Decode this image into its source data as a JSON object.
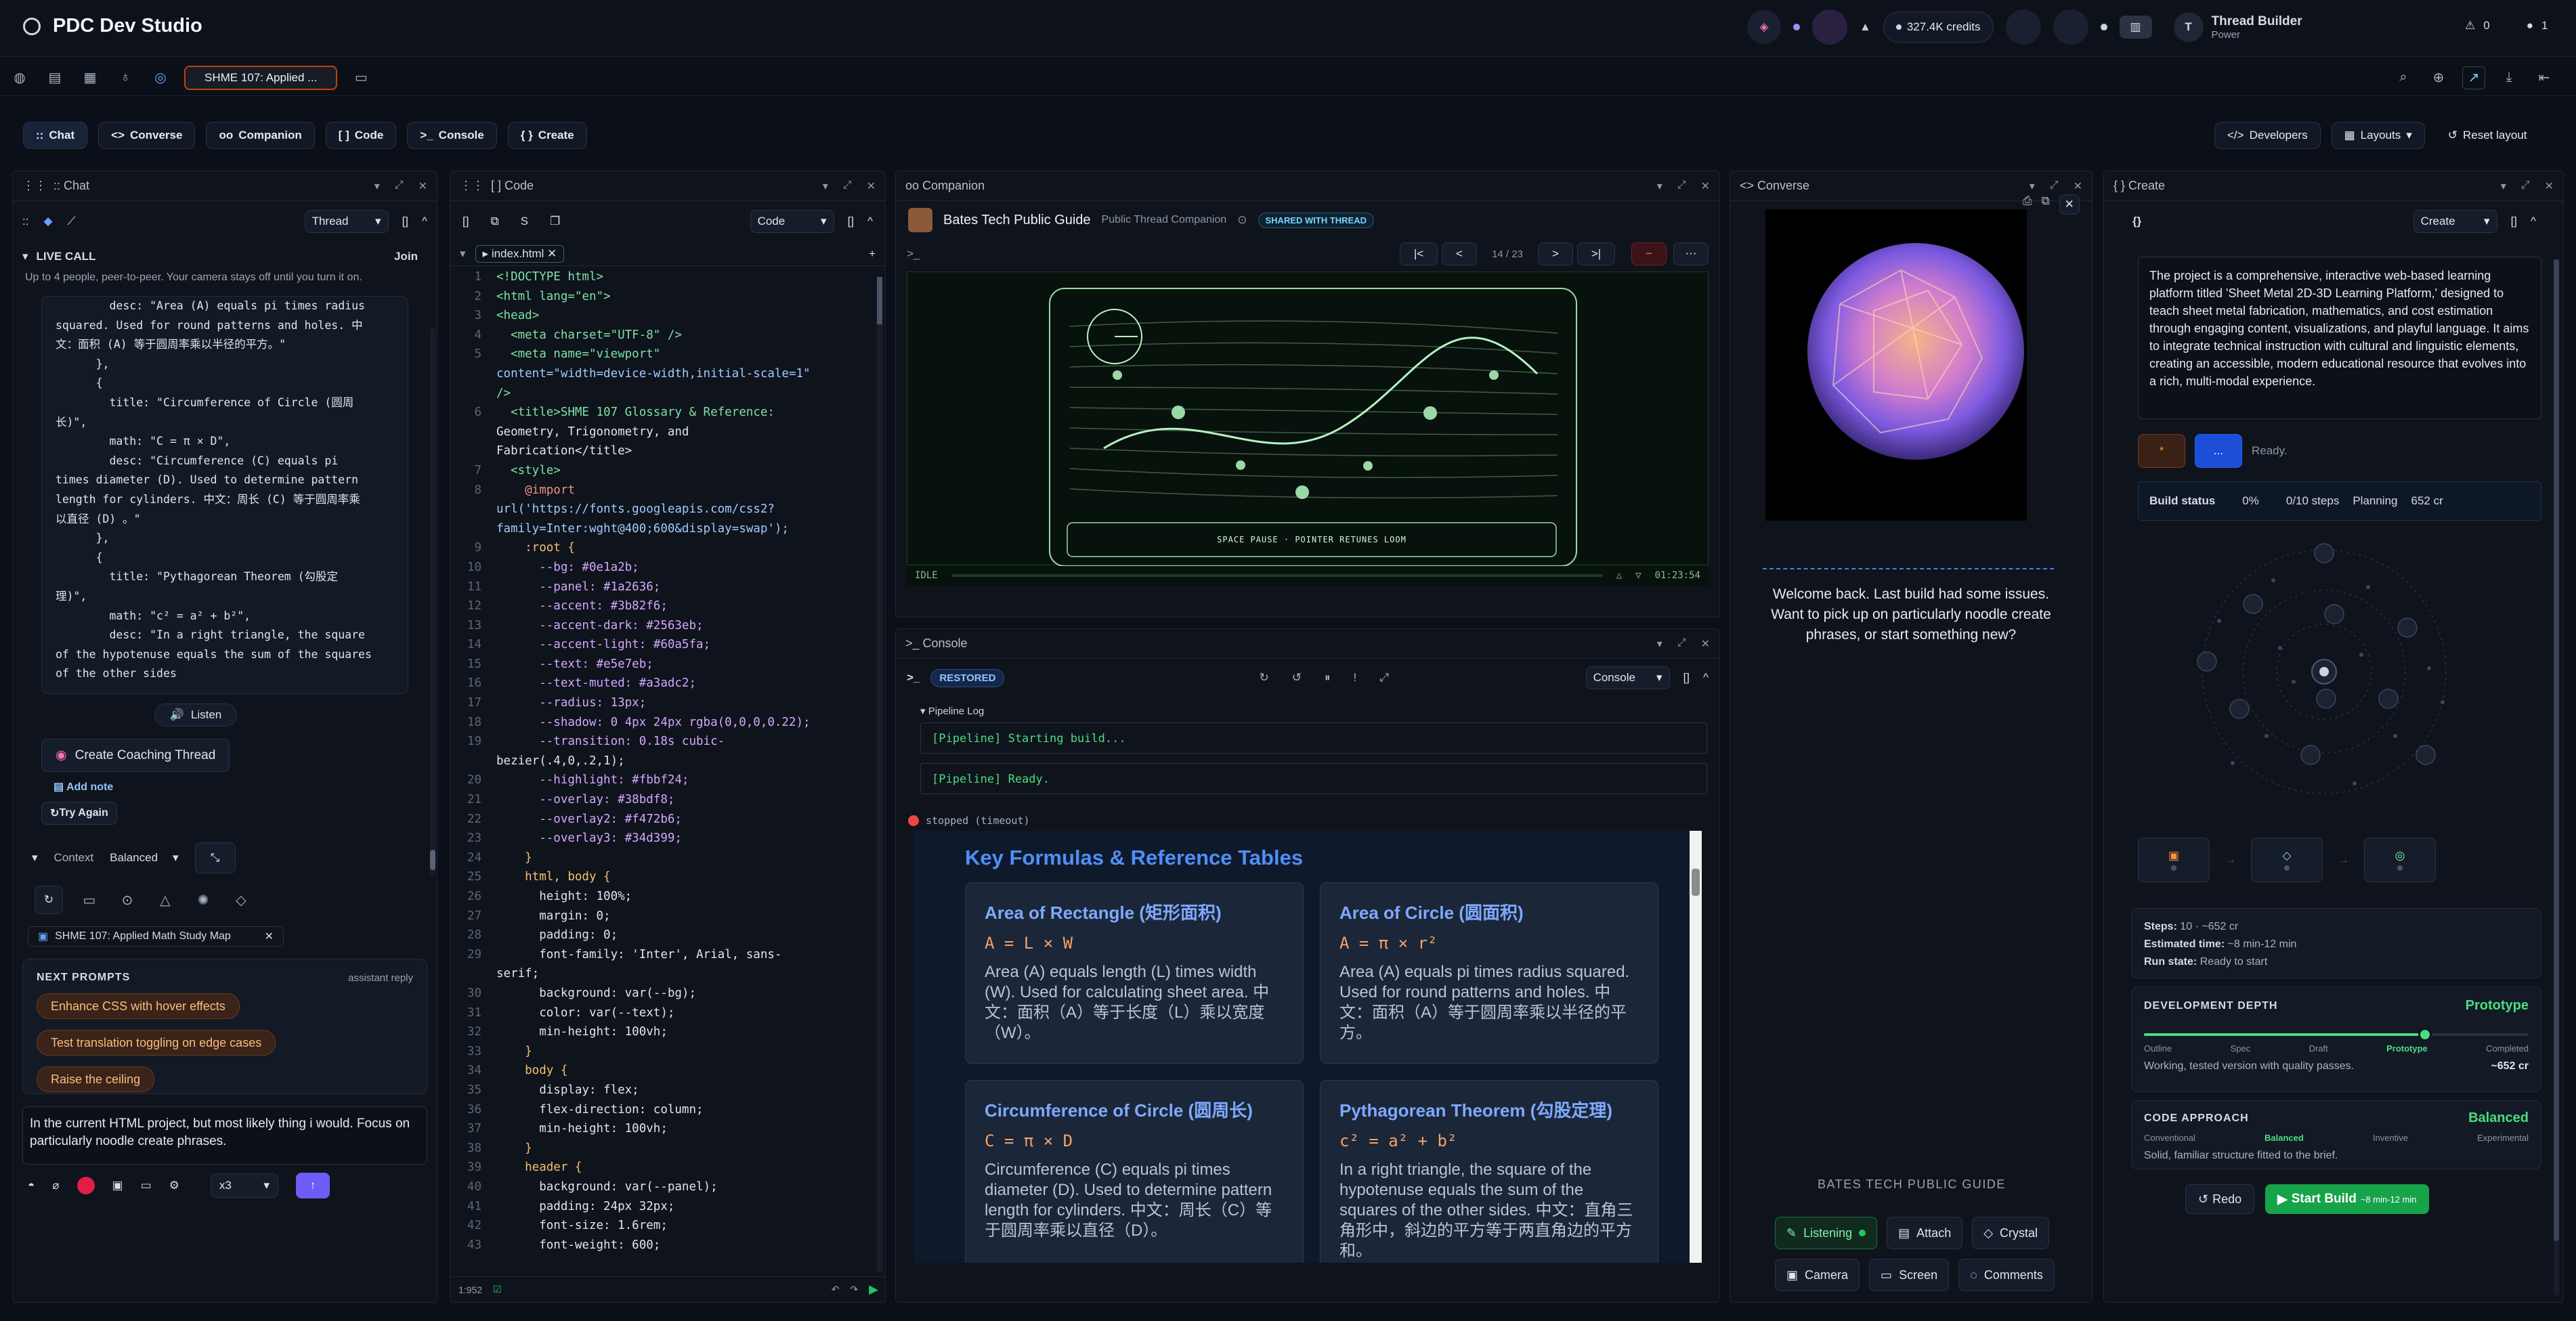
{
  "app": {
    "title": "PDC Dev Studio",
    "credits": "327.4K credits",
    "user_name": "Thread Builder",
    "user_tier": "Power",
    "user_initial": "T",
    "warnings": "0",
    "notifications": "1"
  },
  "tabbar": {
    "active_tab": "SHME 107: Applied ..."
  },
  "modes": [
    "Chat",
    "Converse",
    "Companion",
    "Code",
    "Console",
    "Create"
  ],
  "mode_prefixes": [
    "::",
    "<>",
    "oo",
    "[ ]",
    ">_",
    "{ }"
  ],
  "right_actions": {
    "developers": "Developers",
    "layouts": "Layouts",
    "reset": "Reset layout"
  },
  "chat": {
    "panel_title": ":: Chat",
    "thread_select": "Thread",
    "live_call": {
      "title": "LIVE CALL",
      "join": "Join",
      "desc": "Up to 4 people, peer-to-peer. Your camera stays off until you turn it on."
    },
    "code_lines": [
      "        desc: \"Area (A) equals pi times radius",
      "squared. Used for round patterns and holes. 中",
      "文：面积 (A) 等于圆周率乘以半径的平方。\"",
      "      },",
      "      {",
      "        title: \"Circumference of Circle (圆周",
      "长)\",",
      "        math: \"C = π × D\",",
      "        desc: \"Circumference (C) equals pi",
      "times diameter (D). Used to determine pattern",
      "length for cylinders. 中文：周长 (C) 等于圆周率乘",
      "以直径 (D) 。\"",
      "      },",
      "      {",
      "        title: \"Pythagorean Theorem (勾股定",
      "理)\",",
      "        math: \"c² = a² + b²\",",
      "        desc: \"In a right triangle, the square",
      "of the hypotenuse equals the sum of the squares",
      "of the other sides"
    ],
    "listen": "Listen",
    "create_coaching": "Create Coaching Thread",
    "add_note": "Add note",
    "try_again": "Try Again",
    "context_label": "Context",
    "context_value": "Balanced",
    "context_tag": "SHME 107: Applied Math Study Map",
    "next_prompts_title": "NEXT PROMPTS",
    "next_prompts_meta": "assistant reply",
    "prompts": [
      "Enhance CSS with hover effects",
      "Test translation toggling on edge cases",
      "Raise the ceiling"
    ],
    "input_text": "In the current HTML project, but most likely thing i would. Focus on particularly noodle create phrases.",
    "multiplier": "x3"
  },
  "code": {
    "panel_title": "[ ] Code",
    "mode_select": "Code",
    "file_tab": "index.html",
    "lines": [
      [
        "1",
        "<!DOCTYPE html>"
      ],
      [
        "2",
        "<html lang=\"en\">"
      ],
      [
        "3",
        "<head>"
      ],
      [
        "4",
        "  <meta charset=\"UTF-8\" />"
      ],
      [
        "5",
        "  <meta name=\"viewport\""
      ],
      [
        "",
        "content=\"width=device-width,initial-scale=1\""
      ],
      [
        "",
        "/>"
      ],
      [
        "6",
        "  <title>SHME 107 Glossary & Reference:"
      ],
      [
        "",
        "Geometry, Trigonometry, and"
      ],
      [
        "",
        "Fabrication</title>"
      ],
      [
        "7",
        "  <style>"
      ],
      [
        "8",
        "    @import"
      ],
      [
        "",
        "url('https://fonts.googleapis.com/css2?"
      ],
      [
        "",
        "family=Inter:wght@400;600&display=swap');"
      ],
      [
        "9",
        "    :root {"
      ],
      [
        "10",
        "      --bg: #0e1a2b;"
      ],
      [
        "11",
        "      --panel: #1a2636;"
      ],
      [
        "12",
        "      --accent: #3b82f6;"
      ],
      [
        "13",
        "      --accent-dark: #2563eb;"
      ],
      [
        "14",
        "      --accent-light: #60a5fa;"
      ],
      [
        "15",
        "      --text: #e5e7eb;"
      ],
      [
        "16",
        "      --text-muted: #a3adc2;"
      ],
      [
        "17",
        "      --radius: 13px;"
      ],
      [
        "18",
        "      --shadow: 0 4px 24px rgba(0,0,0,0.22);"
      ],
      [
        "19",
        "      --transition: 0.18s cubic-"
      ],
      [
        "",
        "bezier(.4,0,.2,1);"
      ],
      [
        "20",
        "      --highlight: #fbbf24;"
      ],
      [
        "21",
        "      --overlay: #38bdf8;"
      ],
      [
        "22",
        "      --overlay2: #f472b6;"
      ],
      [
        "23",
        "      --overlay3: #34d399;"
      ],
      [
        "24",
        "    }"
      ],
      [
        "25",
        "    html, body {"
      ],
      [
        "26",
        "      height: 100%;"
      ],
      [
        "27",
        "      margin: 0;"
      ],
      [
        "28",
        "      padding: 0;"
      ],
      [
        "29",
        "      font-family: 'Inter', Arial, sans-"
      ],
      [
        "",
        "serif;"
      ],
      [
        "30",
        "      background: var(--bg);"
      ],
      [
        "31",
        "      color: var(--text);"
      ],
      [
        "32",
        "      min-height: 100vh;"
      ],
      [
        "33",
        "    }"
      ],
      [
        "34",
        "    body {"
      ],
      [
        "35",
        "      display: flex;"
      ],
      [
        "36",
        "      flex-direction: column;"
      ],
      [
        "37",
        "      min-height: 100vh;"
      ],
      [
        "38",
        "    }"
      ],
      [
        "39",
        "    header {"
      ],
      [
        "40",
        "      background: var(--panel);"
      ],
      [
        "41",
        "      padding: 24px 32px;"
      ],
      [
        "42",
        "      font-size: 1.6rem;"
      ],
      [
        "43",
        "      font-weight: 600;"
      ]
    ],
    "cursor_pos": "1:952"
  },
  "companion": {
    "panel_title": "oo Companion",
    "name": "Bates Tech Public Guide",
    "subtitle": "Public Thread Companion",
    "badge": "SHARED WITH THREAD",
    "page_counter": "14 / 23",
    "canvas_caption": "SPACE PAUSE · POINTER RETUNES LOOM",
    "status": "IDLE",
    "time": "01:23:54"
  },
  "console": {
    "panel_title": ">_ Console",
    "restored": "RESTORED",
    "mode_select": "Console",
    "pipeline_title": "▾ Pipeline Log",
    "log": [
      "[Pipeline] Starting build...",
      "[Pipeline] Ready."
    ],
    "stopped": "stopped (timeout)",
    "preview_title": "Key Formulas & Reference Tables",
    "cards": [
      {
        "title": "Area of Rectangle (矩形面积)",
        "math": "A = L × W",
        "desc": "Area (A) equals length (L) times width (W). Used for calculating sheet area. 中文：面积（A）等于长度（L）乘以宽度（W）。"
      },
      {
        "title": "Area of Circle (圆面积)",
        "math": "A = π × r²",
        "desc": "Area (A) equals pi times radius squared. Used for round patterns and holes. 中文：面积（A）等于圆周率乘以半径的平方。"
      },
      {
        "title": "Circumference of Circle (圆周长)",
        "math": "C = π × D",
        "desc": "Circumference (C) equals pi times diameter (D). Used to determine pattern length for cylinders. 中文：周长（C）等于圆周率乘以直径（D）。"
      },
      {
        "title": "Pythagorean Theorem (勾股定理)",
        "math": "c² = a² + b²",
        "desc": "In a right triangle, the square of the hypotenuse equals the sum of the squares of the other sides. 中文：直角三角形中，斜边的平方等于两直角边的平方和。"
      }
    ]
  },
  "converse": {
    "panel_title": "<> Converse",
    "welcome": "Welcome back. Last build had some issues. Want to pick up on particularly noodle create phrases, or start something new?",
    "guide_label": "BATES TECH PUBLIC GUIDE",
    "buttons": [
      "Listening",
      "Attach",
      "Crystal",
      "Camera",
      "Screen",
      "Comments"
    ]
  },
  "create": {
    "panel_title": "{ } Create",
    "mode_select": "Create",
    "description": "The project is a comprehensive, interactive web-based learning platform titled 'Sheet Metal 2D-3D Learning Platform,' designed to teach sheet metal fabrication, mathematics, and cost estimation through engaging content, visualizations, and playful language. It aims to integrate technical instruction with cultural and linguistic elements, creating an accessible, modern educational resource that evolves into a rich, multi-modal experience.",
    "ready": "Ready.",
    "build_status": {
      "label": "Build status",
      "percent": "0%",
      "steps": "0/10 steps",
      "phase": "Planning",
      "cost": "652 cr"
    },
    "summary": {
      "steps_label": "Steps:",
      "steps": "10 · ~652 cr",
      "time_label": "Estimated time:",
      "time": "~8 min-12 min",
      "state_label": "Run state:",
      "state": "Ready to start"
    },
    "depth": {
      "title": "DEVELOPMENT DEPTH",
      "value": "Prototype",
      "level": 0.73,
      "stops": [
        "Outline",
        "Spec",
        "Draft",
        "Prototype",
        "Completed"
      ],
      "note": "Working, tested version with quality passes.",
      "cost": "~652 cr"
    },
    "approach": {
      "title": "CODE APPROACH",
      "value": "Balanced",
      "stops": [
        "Conventional",
        "Balanced",
        "Inventive",
        "Experimental"
      ],
      "note": "Solid, familiar structure fitted to the brief."
    },
    "redo": "Redo",
    "start": "Start Build",
    "start_meta": "~8 min-12 min"
  },
  "colors": {
    "accent": "#3b82f6",
    "green": "#16a34a",
    "bg": "#0b0f17"
  }
}
